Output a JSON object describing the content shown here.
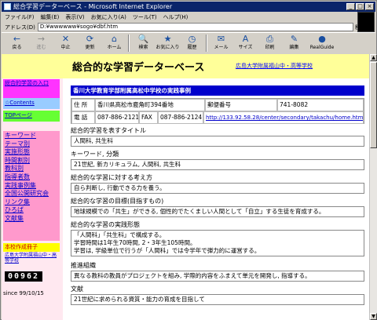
{
  "window": {
    "title": "総合学習データーベース - Microsoft Internet Explorer"
  },
  "menu": [
    "ファイル(F)",
    "編集(E)",
    "表示(V)",
    "お気に入り(A)",
    "ツール(T)",
    "ヘルプ(H)"
  ],
  "address": {
    "label": "アドレス(D)",
    "value": "D:¥wwwwww¥sogo¥dbf.htm",
    "go": "移動"
  },
  "toolbar": [
    {
      "label": "戻る",
      "icon": "←"
    },
    {
      "label": "進む",
      "icon": "→"
    },
    {
      "label": "中止",
      "icon": "✕"
    },
    {
      "label": "更新",
      "icon": "⟳"
    },
    {
      "label": "ホーム",
      "icon": "⌂"
    },
    {
      "label": "検索",
      "icon": "🔍"
    },
    {
      "label": "お気に入り",
      "icon": "★"
    },
    {
      "label": "履歴",
      "icon": "◷"
    },
    {
      "label": "メール",
      "icon": "✉"
    },
    {
      "label": "サイズ",
      "icon": "A"
    },
    {
      "label": "印刷",
      "icon": "⎙"
    },
    {
      "label": "編集",
      "icon": "✎"
    },
    {
      "label": "RealGuide",
      "icon": "●"
    }
  ],
  "header": {
    "site_title": "総合的な学習データーベース",
    "school_link": "広島大学附属福山中・高等学校"
  },
  "sidebar": {
    "box1": "総合的学習の入口",
    "contents": "☆Contents",
    "top": "TOPページ",
    "links": [
      "キーワード",
      "テーマ別",
      "実施形態",
      "時間割別",
      "教科別",
      "指導者数",
      "実践事例集",
      "全国公開研究会",
      "リンク集",
      "ひろば",
      "文献集"
    ],
    "our_school": "本校作成冊子",
    "school_name": "広島大学附属福山中・高等学校",
    "counter": "00962",
    "since": "since 99/10/15"
  },
  "main": {
    "title": "香川大学教育学部附属高松中学校の実践事例",
    "address_label": "住 所",
    "address_value": "香川県高松市鹿角町394番地",
    "postal_label": "郵便番号",
    "postal_value": "741-8082",
    "phone_label": "電 話",
    "phone_value": "087-886-2121",
    "fax_label": "FAX",
    "fax_value": "087-886-2124",
    "url": "http://133.92.58.28/center/secondary/takachu/home.html",
    "sections": [
      {
        "title": "総合的学習を表すタイトル",
        "value": "人間科, 共生科"
      },
      {
        "title": "キーワード, 分類",
        "value": "21世紀, 新カリキュラム, 人間科, 共生科"
      },
      {
        "title": "総合的な学習に対する考え方",
        "value": "自ら判断し, 行動できる力を養う。"
      },
      {
        "title": "総合的な学習の目標(目指すもの)",
        "value": "地球規模での「共生」ができる, 個性的でたくましい人間として「自立」する生徒を育成する。"
      },
      {
        "title": "総合的な学習の実践形態",
        "value": "「人間科」「共生科」で構成する。\n学習時間は1年生70時間, 2・3年生105時間。\n学習は, 学級単位で行うが「人間科」では令学年で弾力的に運営する。"
      },
      {
        "title": "推進組織",
        "value": "異なる教科の教員がプロジェクトを組み, 学際的内容をふまえて単元を開発し, 指導する。"
      },
      {
        "title": "文献",
        "value": "21世紀に求められる資質・能力の育成を目指して"
      }
    ]
  }
}
